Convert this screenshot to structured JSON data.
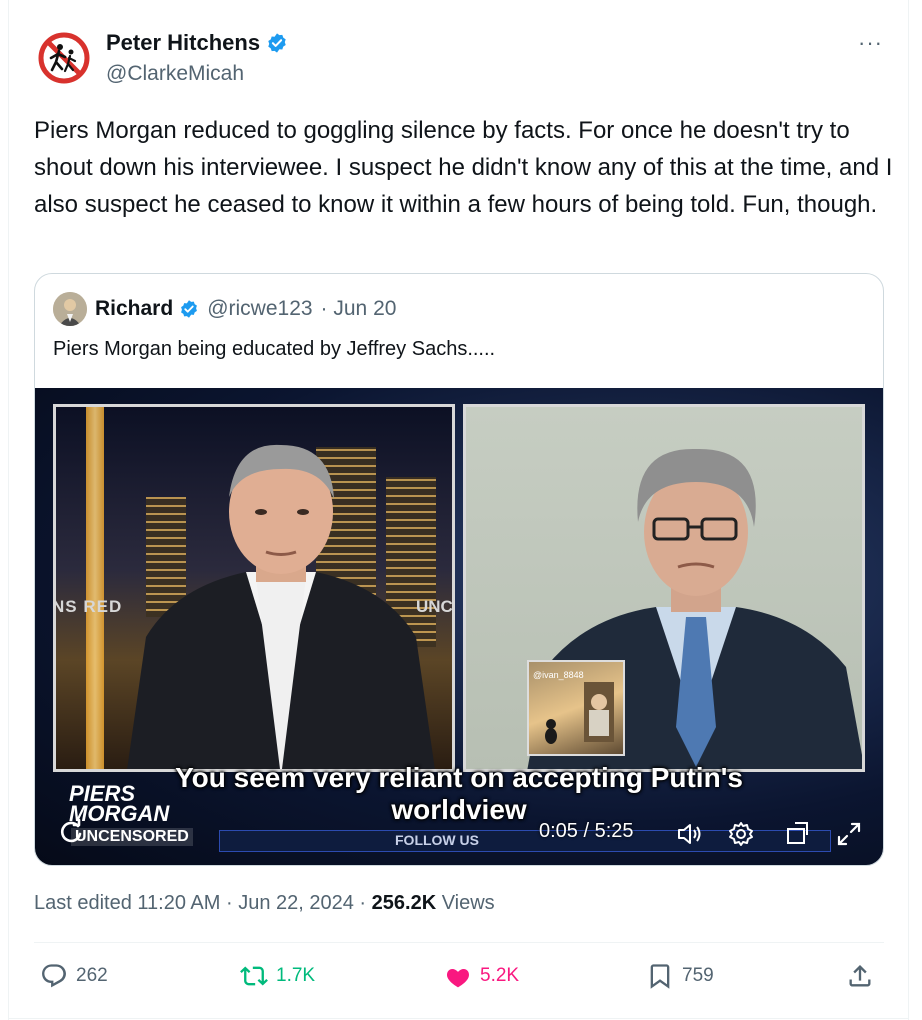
{
  "author": {
    "name": "Peter Hitchens",
    "handle": "@ClarkeMicah",
    "verified": true
  },
  "tweet": {
    "text": "Piers Morgan reduced to goggling silence by facts. For once he doesn't try to shout down his interviewee.  I suspect he didn't know any of this at the time, and I also suspect he ceased to know it within a few hours of being told. Fun,  though."
  },
  "quote": {
    "name": "Richard",
    "handle": "@ricwe123",
    "date": "· Jun 20",
    "text": "Piers Morgan being educated by Jeffrey Sachs.....",
    "video": {
      "caption_line1": "You seem very reliant on accepting Putin's",
      "caption_line2": "worldview",
      "time": "0:05 / 5:25",
      "logo_line1": "PIERS",
      "logo_line2": "MORGAN",
      "logo_line3": "UNCENSORED",
      "sign_left": "NS  RED",
      "sign_right": "UNC",
      "follow_text": "FOLLOW US",
      "inset_tag": "@ivan_8848",
      "progress": 0.016
    }
  },
  "meta": {
    "edited": "Last edited 11:20 AM · Jun 22, 2024 · ",
    "views_count": "256.2K",
    "views_label": " Views"
  },
  "actions": {
    "replies": "262",
    "reposts": "1.7K",
    "likes": "5.2K",
    "bookmarks": "759"
  },
  "colors": {
    "verified": "#1d9bf0",
    "repost": "#00ba7c",
    "like": "#f91880",
    "muted": "#536471"
  },
  "icons": [
    "more-icon",
    "verified-icon",
    "replay-icon",
    "volume-icon",
    "settings-icon",
    "minimize-icon",
    "fullscreen-icon",
    "reply-icon",
    "repost-icon",
    "like-icon",
    "bookmark-icon",
    "share-icon"
  ]
}
